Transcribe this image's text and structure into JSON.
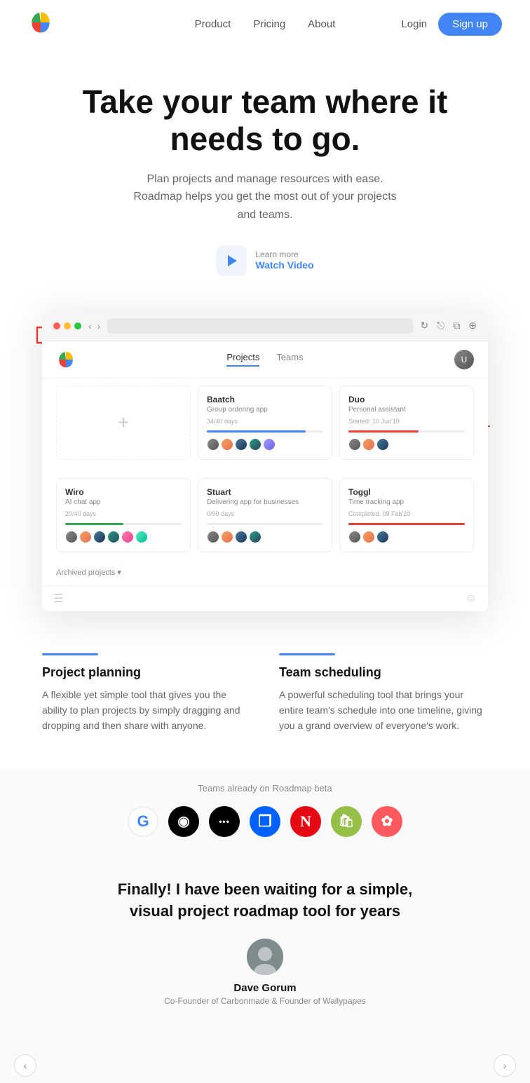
{
  "nav": {
    "links": [
      {
        "id": "product",
        "label": "Product"
      },
      {
        "id": "pricing",
        "label": "Pricing"
      },
      {
        "id": "about",
        "label": "About"
      }
    ],
    "login_label": "Login",
    "signup_label": "Sign up"
  },
  "hero": {
    "heading_line1": "Take your team where it",
    "heading_line2": "needs to go.",
    "subtext": "Plan projects and manage resources with ease. Roadmap helps you get the most out of your projects and teams.",
    "learn_more": "Learn more",
    "watch_video": "Watch Video"
  },
  "browser": {
    "tabs": [
      {
        "id": "projects",
        "label": "Projects",
        "active": true
      },
      {
        "id": "teams",
        "label": "Teams",
        "active": false
      }
    ],
    "projects": [
      {
        "name": "Baatch",
        "desc": "Group ordering app",
        "date": "34/40 days",
        "bar_color": "#4285f4",
        "bar_pct": 85,
        "avatars": 5
      },
      {
        "name": "Duo",
        "desc": "Personal assistant",
        "date": "Started: 10 Jun'19",
        "bar_color": "#ea4335",
        "bar_pct": 60,
        "avatars": 3
      }
    ],
    "projects_row2": [
      {
        "name": "Wiro",
        "desc": "AI chat app",
        "date": "20/40 days",
        "bar_color": "#34a853",
        "bar_pct": 50,
        "avatars": 6
      },
      {
        "name": "Stuart",
        "desc": "Delivering app for businesses",
        "date": "0/90 days",
        "bar_color": "#fbbc04",
        "bar_pct": 0,
        "avatars": 4
      },
      {
        "name": "Toggl",
        "desc": "Time tracking app",
        "date": "Completed: 09 Feb'20",
        "bar_color": "#ea4335",
        "bar_pct": 100,
        "avatars": 3
      }
    ],
    "archived_label": "Archived projects ▾"
  },
  "features": [
    {
      "id": "project-planning",
      "title": "Project planning",
      "description": "A flexible yet simple tool that gives you the ability to plan projects by simply dragging and dropping and then share with anyone.",
      "line_color": "#4285f4"
    },
    {
      "id": "team-scheduling",
      "title": "Team scheduling",
      "description": "A powerful scheduling tool that brings your entire team's schedule into one timeline, giving you a grand overview of everyone's work.",
      "line_color": "#4285f4"
    }
  ],
  "teams": {
    "label": "Teams already on Roadmap beta",
    "logos": [
      {
        "id": "google",
        "symbol": "G",
        "bg": "#fff",
        "color": "#4285f4",
        "border": "2px solid #eee"
      },
      {
        "id": "adidas",
        "symbol": "◉",
        "bg": "#000",
        "color": "#fff",
        "border": "none"
      },
      {
        "id": "medium",
        "symbol": "···",
        "bg": "#000",
        "color": "#fff",
        "border": "none"
      },
      {
        "id": "dropbox",
        "symbol": "❐",
        "bg": "#0061ff",
        "color": "#fff",
        "border": "none"
      },
      {
        "id": "netflix",
        "symbol": "N",
        "bg": "#e50914",
        "color": "#fff",
        "border": "none"
      },
      {
        "id": "shopify",
        "symbol": "🛍",
        "bg": "#96bf48",
        "color": "#fff",
        "border": "none"
      },
      {
        "id": "airbnb",
        "symbol": "✿",
        "bg": "#ff5a5f",
        "color": "#fff",
        "border": "none"
      }
    ]
  },
  "testimonial": {
    "quote": "Finally! I have been waiting for a simple, visual project roadmap tool for years",
    "name": "Dave Gorum",
    "role": "Co-Founder of Carbonmade & Founder of Wallypapes"
  }
}
